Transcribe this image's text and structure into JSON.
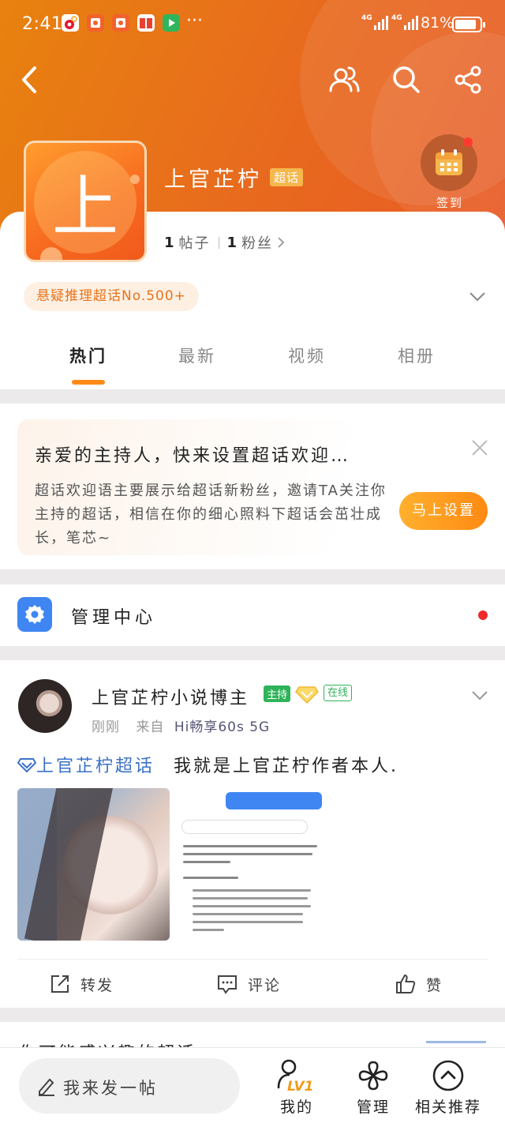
{
  "status_bar": {
    "time": "2:41",
    "dots": "···",
    "net1": "4G",
    "net2": "4G",
    "battery": "81%"
  },
  "topic": {
    "avatar_char": "上",
    "name": "上官芷柠",
    "badge": "超话",
    "checkin": "签到",
    "posts_count": "1",
    "posts_label": "帖子",
    "fans_count": "1",
    "fans_label": "粉丝",
    "rank": "悬疑推理超话No.500+"
  },
  "tabs": [
    "热门",
    "最新",
    "视频",
    "相册"
  ],
  "welcome": {
    "title": "亲爱的主持人，快来设置超话欢迎…",
    "desc": "超话欢迎语主要展示给超话新粉丝，邀请TA关注你主持的超话，相信在你的细心照料下超话会茁壮成长，笔芯~",
    "button": "马上设置"
  },
  "manage": {
    "label": "管理中心"
  },
  "post": {
    "user": "上官芷柠小说博主",
    "host_badge": "主持",
    "online_badge": "在线",
    "time": "刚刚",
    "source_prefix": "来自",
    "device": "Hi畅享60s 5G",
    "topic_tag": "上官芷柠超话",
    "text": "我就是上官芷柠作者本人.",
    "actions": {
      "repost": "转发",
      "comment": "评论",
      "like": "赞"
    }
  },
  "next_section": {
    "title": "你可能感兴趣的超话"
  },
  "bottom": {
    "input": "我来发一帖",
    "level": "LV1",
    "mine": "我的",
    "manage": "管理",
    "recommend": "相关推荐"
  }
}
